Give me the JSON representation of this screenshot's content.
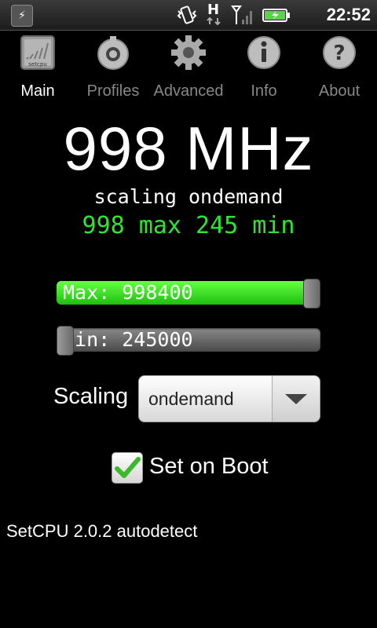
{
  "status_bar": {
    "clock": "22:52",
    "icons": [
      "app-notification-icon",
      "vibrate-icon",
      "hspa-data-icon",
      "signal-icon",
      "battery-charging-icon"
    ],
    "network_type": "H"
  },
  "tabs": [
    {
      "label": "Main",
      "icon": "setcpu-chip-icon",
      "active": true
    },
    {
      "label": "Profiles",
      "icon": "profile-dial-icon",
      "active": false
    },
    {
      "label": "Advanced",
      "icon": "gear-icon",
      "active": false
    },
    {
      "label": "Info",
      "icon": "info-icon",
      "active": false
    },
    {
      "label": "About",
      "icon": "help-icon",
      "active": false
    }
  ],
  "main": {
    "current_frequency": "998 MHz",
    "governor_line": "scaling ondemand",
    "range_line": "998 max 245 min",
    "max_slider": {
      "label": "Max: 998400",
      "value_fraction": 1.0
    },
    "min_slider": {
      "label": "Min: 245000",
      "value_fraction": 0.0
    },
    "scaling_label": "Scaling",
    "scaling_selected": "ondemand",
    "set_on_boot_label": "Set on Boot",
    "set_on_boot_checked": true,
    "footer": "SetCPU 2.0.2 autodetect"
  },
  "colors": {
    "accent_green": "#2fe52f",
    "background": "#000000",
    "inactive_tab": "#888888"
  },
  "icon_images": {
    "chip_caption": "setcpu"
  }
}
